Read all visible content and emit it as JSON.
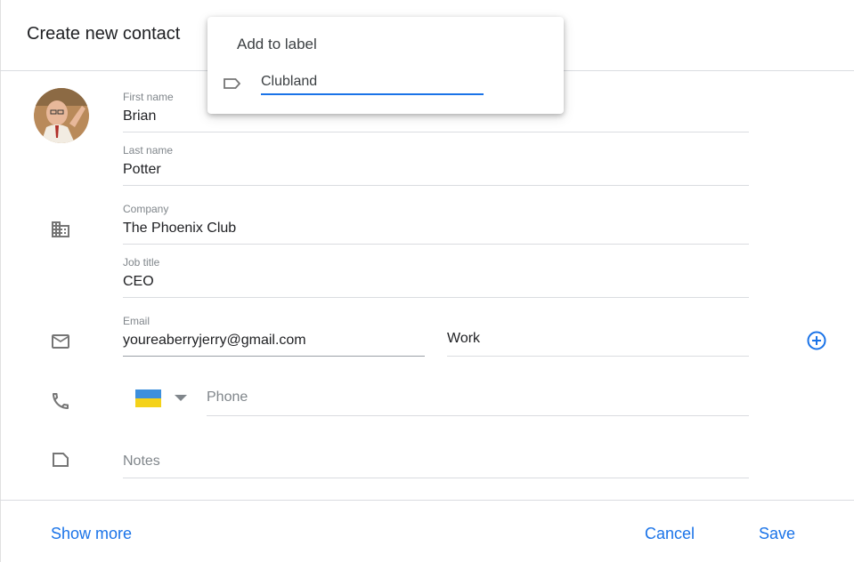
{
  "header": {
    "title": "Create new contact"
  },
  "fields": {
    "first_name": {
      "label": "First name",
      "value": "Brian"
    },
    "last_name": {
      "label": "Last name",
      "value": "Potter"
    },
    "company": {
      "label": "Company",
      "value": "The Phoenix Club"
    },
    "job_title": {
      "label": "Job title",
      "value": "CEO"
    },
    "email": {
      "label": "Email",
      "value": "youreaberryjerry@gmail.com",
      "type": "Work"
    },
    "phone": {
      "placeholder": "Phone",
      "country_flag": "ukraine-flag"
    },
    "notes": {
      "placeholder": "Notes"
    }
  },
  "footer": {
    "show_more": "Show more",
    "cancel": "Cancel",
    "save": "Save"
  },
  "label_popup": {
    "title": "Add to label",
    "input_value": "Clubland",
    "icon": "label-icon"
  },
  "icons": [
    "building-icon",
    "email-icon",
    "phone-icon",
    "notes-icon",
    "add-circle-icon"
  ],
  "colors": {
    "accent": "#1a73e8",
    "divider": "#dadce0",
    "label_text": "#80868b"
  }
}
